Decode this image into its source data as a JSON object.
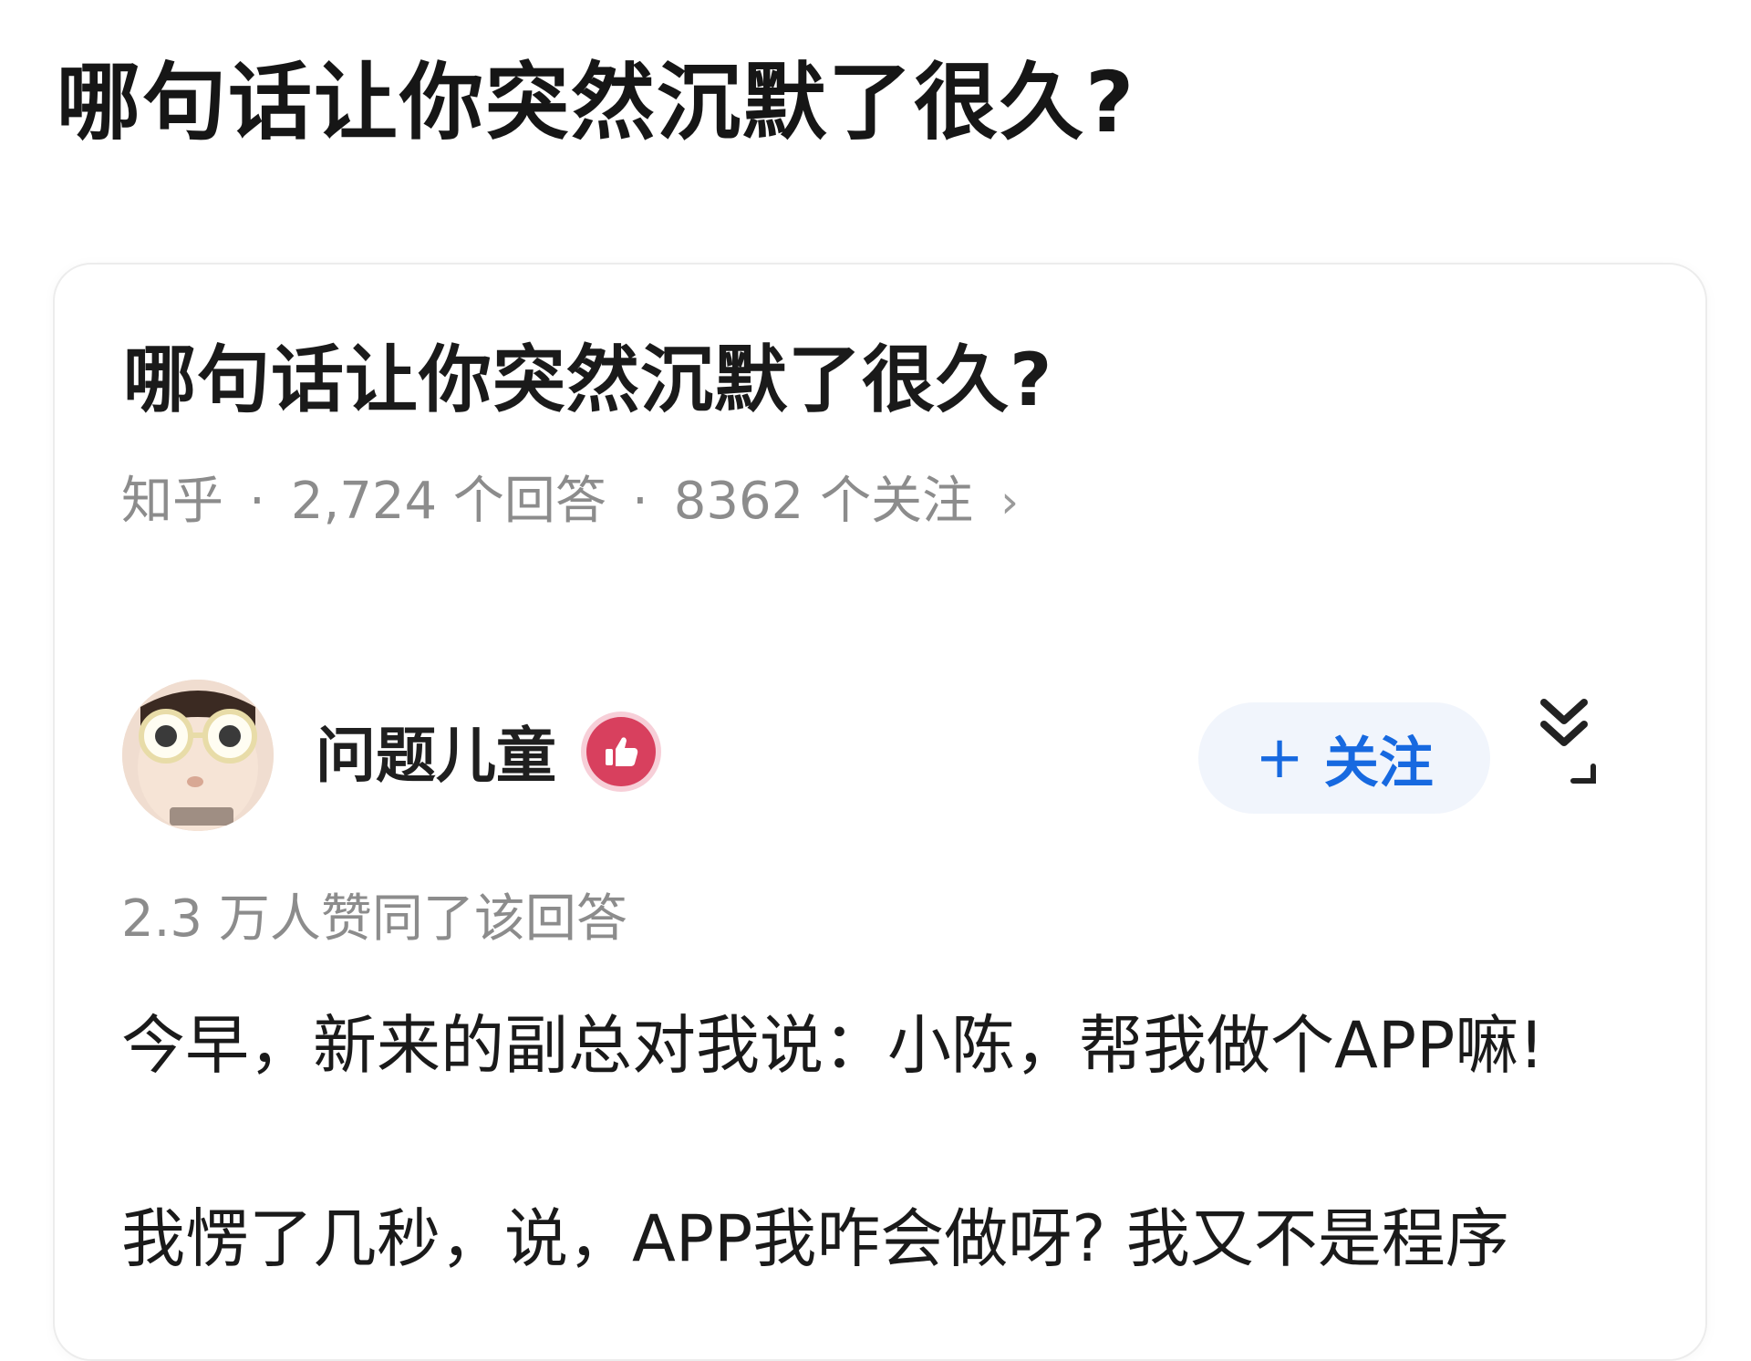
{
  "page": {
    "title": "哪句话让你突然沉默了很久?"
  },
  "question_card": {
    "title": "哪句话让你突然沉默了很久?",
    "meta": {
      "source": "知乎",
      "separator": "·",
      "answers": "2,724 个回答",
      "followers": "8362 个关注",
      "chevron": "›"
    },
    "author": {
      "name": "问题儿童",
      "badge_icon": "thumbs-up-badge-icon",
      "avatar_icon": "avatar-sunglasses-baby",
      "follow_plus": "+",
      "follow_label": "关注",
      "expand_icon": "double-chevron-down-icon"
    },
    "vote_text": "2.3 万人赞同了该回答",
    "paragraphs": [
      "今早，新来的副总对我说：小陈，帮我做个APP嘛!",
      "我愣了几秒，说，APP我咋会做呀? 我又不是程序"
    ]
  },
  "colors": {
    "accent": "#1769e0",
    "follow_bg": "#f1f5fc",
    "muted_text": "#8c8c8c",
    "badge": "#d8405e"
  }
}
